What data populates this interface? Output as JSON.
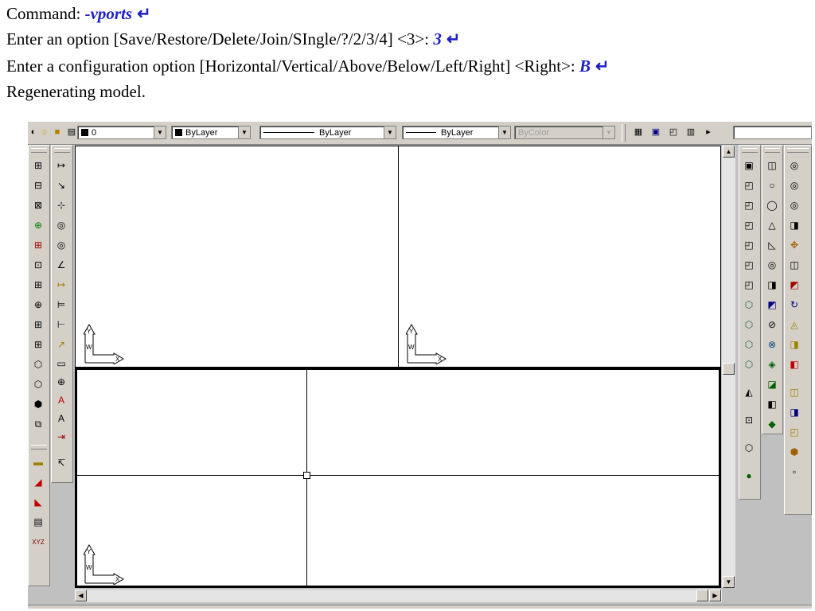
{
  "command_lines": {
    "line1_prefix": "Command: ",
    "line1_input": "-vports",
    "line2_prefix": "Enter an option [Save/Restore/Delete/Join/SIngle/?/2/3/4] <3>: ",
    "line2_input": "3",
    "line3_prefix": "Enter a configuration option [Horizontal/Vertical/Above/Below/Left/Right] <Right>: ",
    "line3_input": "B",
    "line4": "Regenerating model.",
    "enter_symbol": "↵"
  },
  "properties_toolbar": {
    "layer_value": "0",
    "color_value": "ByLayer",
    "linetype_value": "ByLayer",
    "lineweight_value": "ByLayer",
    "plotstyle_value": "ByColor",
    "dropdown_arrow": "▼"
  },
  "ucs_icon": {
    "y_label": "Y",
    "w_label": "W",
    "x_label": "X"
  },
  "scroll_arrows": {
    "up": "▲",
    "down": "▼",
    "left": "◀",
    "right": "▶"
  },
  "icons": {
    "layer_tools": [
      "layers-icon",
      "sun-icon",
      "lock-icon",
      "layer-color-icon"
    ],
    "view_toolbar": [
      "named-views-icon",
      "single-viewport-icon",
      "floating-viewport-icon",
      "clip-viewport-icon",
      "viewport-scale-icon"
    ],
    "left_toolbar_1": [
      "insert-block-icon",
      "make-block-icon",
      "block-edit-icon",
      "attach-xref-icon",
      "xref-edit-icon",
      "bind-xref-icon",
      "refedit-icon",
      "insert-icon",
      "dimension-icon",
      "3d-icon",
      "3d-array-icon",
      "3d-mirror-icon",
      "3d-rotate-icon",
      "3d-align-icon"
    ],
    "left_toolbar_2": [
      "linear-dim-icon",
      "aligned-dim-icon",
      "ordinate-dim-icon",
      "radius-dim-icon",
      "diameter-dim-icon",
      "angular-dim-icon",
      "quick-dim-icon",
      "baseline-dim-icon",
      "continue-dim-icon",
      "leader-icon",
      "tolerance-icon",
      "center-mark-icon",
      "dim-edit-icon",
      "dim-text-edit-icon",
      "dim-update-icon",
      "dim-style-icon"
    ],
    "left_toolbar_3": [
      "table-icon",
      "hatch-icon",
      "gradient-icon",
      "mtext-icon",
      "xyz-icon"
    ],
    "right_toolbar_1": [
      "view-icon",
      "solid-box-icon",
      "solid-wedge-icon",
      "solid-cone-icon",
      "solid-sphere-icon",
      "solid-cylinder-icon",
      "solid-torus-icon",
      "shade-icon",
      "hide-icon",
      "render-icon",
      "light-icon",
      "scene-icon",
      "material-icon",
      "iso-view-icon",
      "orbit-icon"
    ],
    "right_toolbar_2": [
      "box-icon",
      "sphere-icon",
      "cylinder-icon",
      "cone-icon",
      "wedge-icon",
      "torus-icon",
      "extrude-icon",
      "revolve-icon",
      "slice-icon",
      "section-icon",
      "interfere-icon",
      "union-icon",
      "subtract-icon",
      "intersect-icon"
    ],
    "right_toolbar_3": [
      "solidedit-union-icon",
      "solidedit-subtract-icon",
      "solidedit-intersect-icon",
      "extrude-faces-icon",
      "move-faces-icon",
      "offset-faces-icon",
      "delete-faces-icon",
      "rotate-faces-icon",
      "taper-faces-icon",
      "color-faces-icon",
      "copy-edges-icon",
      "color-edges-icon",
      "imprint-icon",
      "clean-icon",
      "separate-icon",
      "shell-icon",
      "check-icon"
    ]
  },
  "colors": {
    "input_text": "#1f1fc8",
    "window_bg": "#c0c0c0",
    "toolbar_bg": "#d4d0c8"
  }
}
